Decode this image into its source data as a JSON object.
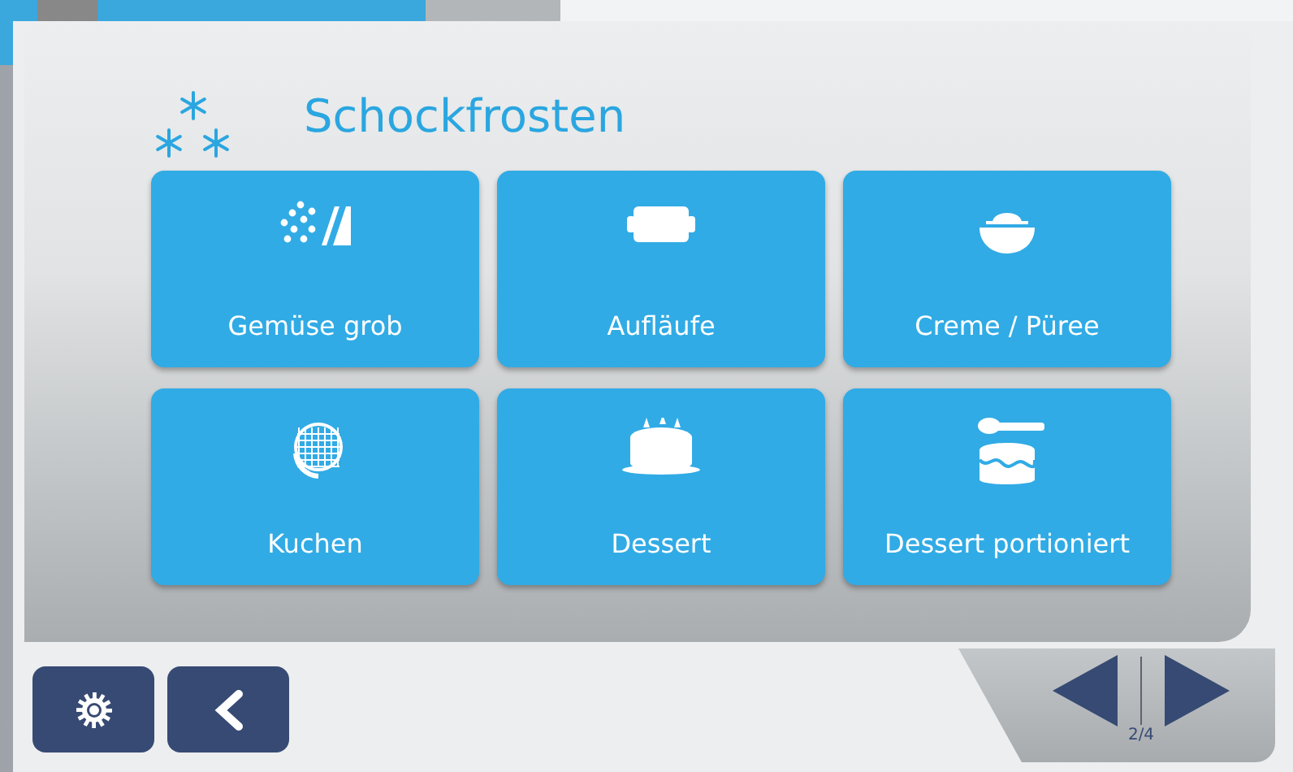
{
  "header": {
    "title": "Schockfrosten"
  },
  "programs": [
    {
      "label": "Gemüse grob",
      "kind": "vegetables"
    },
    {
      "label": "Aufläufe",
      "kind": "casserole"
    },
    {
      "label": "Creme / Püree",
      "kind": "bowl"
    },
    {
      "label": "Kuchen",
      "kind": "cake-slice"
    },
    {
      "label": "Dessert",
      "kind": "cake"
    },
    {
      "label": "Dessert portioniert",
      "kind": "portion"
    }
  ],
  "pager": {
    "page": "2/4"
  }
}
